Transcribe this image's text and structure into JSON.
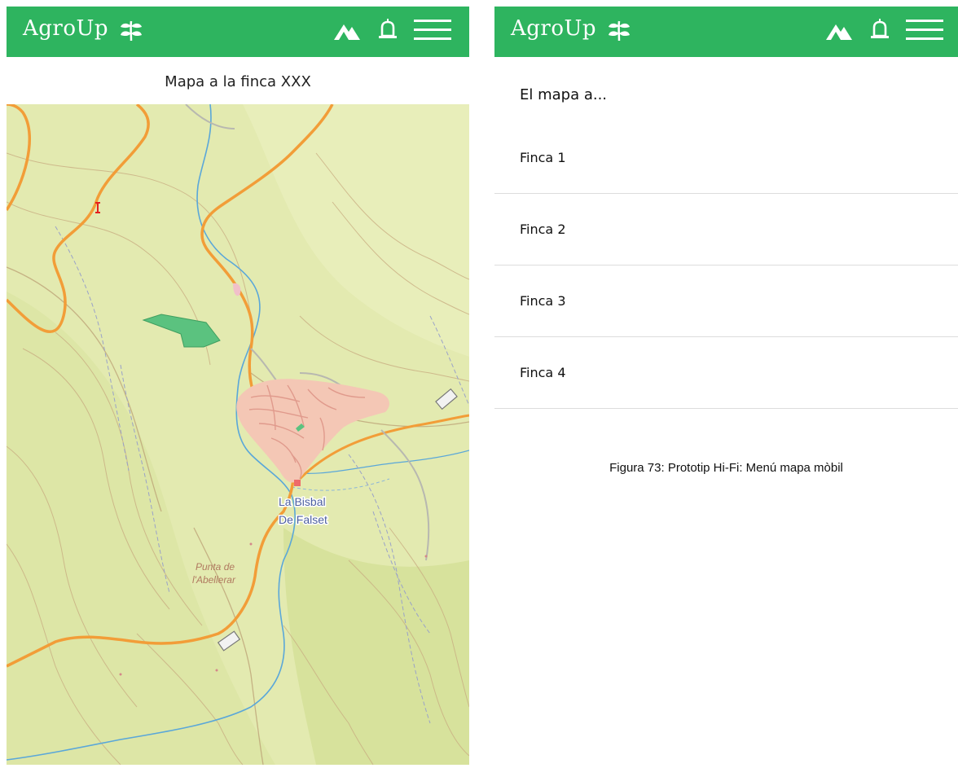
{
  "left_screen": {
    "brand": "AgroUp",
    "title": "Mapa a la finca XXX",
    "map": {
      "town_label_1": "La Bisbal",
      "town_label_2": "De Falset",
      "peak_label_1": "Punta de",
      "peak_label_2": "l'Abellerar"
    }
  },
  "right_screen": {
    "brand": "AgroUp",
    "heading": "El mapa a...",
    "items": [
      {
        "label": "Finca 1"
      },
      {
        "label": "Finca 2"
      },
      {
        "label": "Finca 3"
      },
      {
        "label": "Finca 4"
      }
    ]
  },
  "caption": "Figura 73: Prototip Hi-Fi: Menú mapa mòbil",
  "colors": {
    "brand_green": "#2eb45f",
    "map_base": "#e6ecb4",
    "road": "#f29d38",
    "river": "#5aa7d9",
    "parcel": "#5bc27f"
  },
  "icons": [
    "leaf-icon",
    "mountain-icon",
    "bell-icon",
    "hamburger-menu-icon"
  ]
}
